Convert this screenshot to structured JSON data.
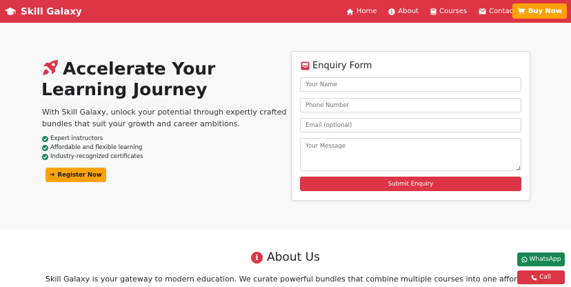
{
  "navbar": {
    "brand": "Skill Galaxy",
    "links": [
      {
        "label": "Home",
        "icon": "home-icon"
      },
      {
        "label": "About",
        "icon": "info-icon"
      },
      {
        "label": "Courses",
        "icon": "book-icon"
      },
      {
        "label": "Contact",
        "icon": "envelope-icon"
      }
    ],
    "buy_label": "Buy Now"
  },
  "hero": {
    "title": "Accelerate Your Learning Journey",
    "description": "With Skill Galaxy, unlock your potential through expertly crafted bundles that suit your growth and career ambitions.",
    "features": [
      "Expert instructors",
      "Affordable and flexible learning",
      "Industry-recognized certificates"
    ],
    "register_label": "Register Now"
  },
  "form": {
    "title": "Enquiry Form",
    "name_placeholder": "Your Name",
    "phone_placeholder": "Phone Number",
    "email_placeholder": "Email (optional)",
    "message_placeholder": "Your Message",
    "submit_label": "Submit Enquiry"
  },
  "about": {
    "title": "About Us",
    "text": "Skill Galaxy is your gateway to modern education. We curate powerful bundles that combine multiple courses into one affordab"
  },
  "floating": {
    "whatsapp_label": "WhatsApp",
    "call_label": "Call"
  },
  "colors": {
    "brand_red": "#dc3545",
    "accent_orange": "#ffa20a",
    "success_green": "#198754",
    "hero_bg": "#f8f8f9"
  }
}
